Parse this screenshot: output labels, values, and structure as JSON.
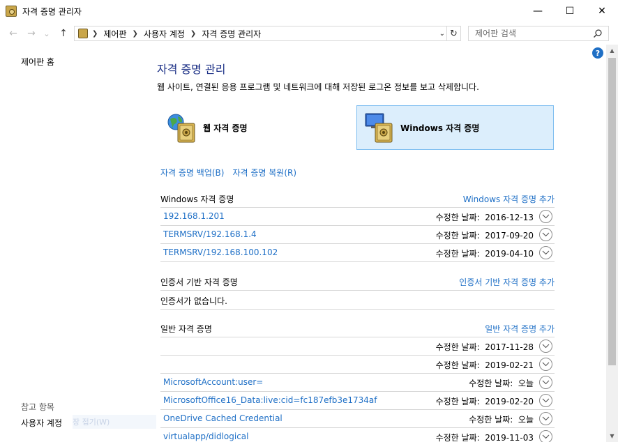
{
  "window": {
    "title": "자격 증명 관리자",
    "controls": {
      "minimize": "—",
      "maximize": "☐",
      "close": "✕"
    }
  },
  "nav": {
    "back": "←",
    "forward": "→",
    "recent": "⌄",
    "up": "↑",
    "breadcrumb": [
      "제어판",
      "사용자 계정",
      "자격 증명 관리자"
    ],
    "dropdown": "⌄",
    "refresh": "↻"
  },
  "search": {
    "placeholder": "제어판 검색"
  },
  "left_pane": {
    "home": "제어판 홈",
    "see_also_heading": "참고 항목",
    "see_also_items": [
      "사용자 계정"
    ],
    "ghost_text": "장 접기(W)"
  },
  "help": {
    "label": "?"
  },
  "main": {
    "title": "자격 증명 관리",
    "description": "웹 사이트, 연결된 응용 프로그램 및 네트워크에 대해 저장된 로그온 정보를 보고 삭제합니다.",
    "tiles": [
      {
        "label": "웹 자격 증명",
        "selected": false
      },
      {
        "label": "Windows 자격 증명",
        "selected": true
      }
    ],
    "backup": "자격 증명 백업(B)",
    "restore": "자격 증명 복원(R)"
  },
  "sections": {
    "windows": {
      "title": "Windows 자격 증명",
      "add": "Windows 자격 증명 추가",
      "items": [
        {
          "name": "192.168.1.201",
          "date": "수정한 날짜:  2016-12-13"
        },
        {
          "name": "TERMSRV/192.168.1.4",
          "date": "수정한 날짜:  2017-09-20"
        },
        {
          "name": "TERMSRV/192.168.100.102",
          "date": "수정한 날짜:  2019-04-10"
        }
      ]
    },
    "certificate": {
      "title": "인증서 기반 자격 증명",
      "add": "인증서 기반 자격 증명 추가",
      "empty": "인증서가 없습니다."
    },
    "generic": {
      "title": "일반 자격 증명",
      "add": "일반 자격 증명 추가",
      "items": [
        {
          "name": "",
          "date": "수정한 날짜:  2017-11-28"
        },
        {
          "name": "",
          "date": "수정한 날짜:  2019-02-21"
        },
        {
          "name": "MicrosoftAccount:user=",
          "date": "수정한 날짜:  오늘"
        },
        {
          "name": "MicrosoftOffice16_Data:live:cid=fc187efb3e1734af",
          "date": "수정한 날짜:  2019-02-20"
        },
        {
          "name": "OneDrive Cached Credential",
          "date": "수정한 날짜:  오늘"
        },
        {
          "name": "virtualapp/didlogical",
          "date": "수정한 날짜:  2019-11-03"
        }
      ]
    }
  },
  "colors": {
    "link": "#1e6fc6",
    "title": "#1e3287",
    "selected_tile_bg": "#dceefc",
    "selected_tile_border": "#7fbef0",
    "help": "#1f6fc5"
  }
}
